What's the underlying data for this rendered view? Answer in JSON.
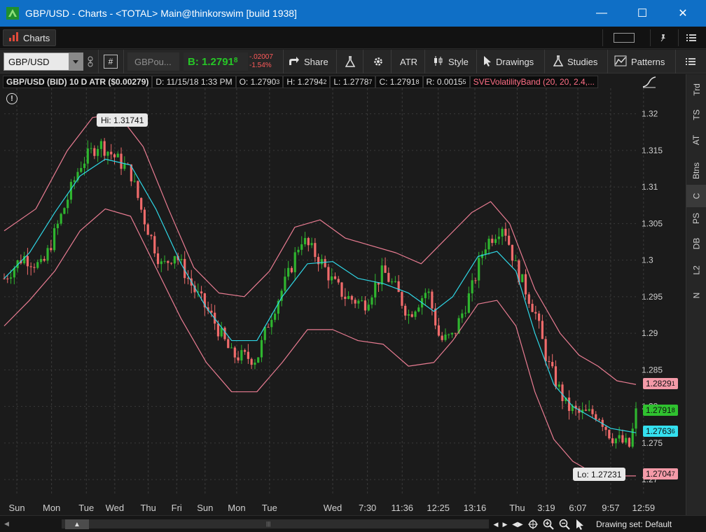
{
  "window": {
    "title": "GBP/USD - Charts - <TOTAL> Main@thinkorswim [build 1938]",
    "minimize_glyph": "—",
    "maximize_glyph": "☐",
    "close_glyph": "✕"
  },
  "bar2": {
    "charts_label": "Charts"
  },
  "toolbar": {
    "symbol": "GBP/USD",
    "hash": "#",
    "symbol2": "GBPou...",
    "bid_label": "B: 1.2791",
    "bid_sub": "8",
    "change": "-.02007",
    "change_pct": "-1.54%",
    "share": "Share",
    "atr": "ATR",
    "style": "Style",
    "drawings": "Drawings",
    "studies": "Studies",
    "patterns": "Patterns"
  },
  "chart_header": {
    "title": "GBP/USD (BID) 10 D ATR ($0.00279)",
    "d": "D: 11/15/18 1:33 PM",
    "o": "O: 1.2790",
    "o_sub": "3",
    "h": "H: 1.2794",
    "h_sub": "2",
    "l": "L: 1.2778",
    "l_sub": "7",
    "c": "C: 1.2791",
    "c_sub": "8",
    "r": "R: 0.0015",
    "r_sub": "5",
    "study": "SVEVolatilityBand (20, 20, 2.4,..."
  },
  "info_glyph": "!",
  "callouts": {
    "hi": "Hi: 1.31741",
    "lo": "Lo: 1.27231"
  },
  "price_tags": {
    "upper": "1.2829",
    "upper_sub": "1",
    "close": "1.2791",
    "close_sub": "8",
    "mid": "1.2763",
    "mid_sub": "6",
    "lower": "1.2704",
    "lower_sub": "7"
  },
  "right_tabs": [
    "Trd",
    "TS",
    "AT",
    "Btns",
    "C",
    "PS",
    "DB",
    "L2",
    "N"
  ],
  "bottom": {
    "drawing_set": "Drawing set: Default"
  },
  "colors": {
    "up": "#2fb52f",
    "down": "#f06b6b",
    "band": "#e97c92",
    "mid": "#2fd7e6",
    "grid": "#3a3a3a",
    "bid": "#26c726"
  },
  "chart_data": {
    "type": "candlestick",
    "title": "GBP/USD (BID) 10 D ATR ($0.00279)",
    "ylim": [
      1.268,
      1.3235
    ],
    "y_ticks": [
      "1.32",
      "1.315",
      "1.31",
      "1.305",
      "1.3",
      "1.295",
      "1.29",
      "1.285",
      "1.28",
      "1.275",
      "1.27"
    ],
    "x_ticks": [
      "Sun",
      "Mon",
      "Tue",
      "Wed",
      "Thu",
      "Fri",
      "Sun",
      "Mon",
      "Tue",
      "Wed",
      "7:30",
      "11:36",
      "12:25",
      "13:16",
      "Thu",
      "3:19",
      "6:07",
      "9:57",
      "12:59"
    ],
    "x_tick_positions": [
      0.02,
      0.075,
      0.13,
      0.175,
      0.228,
      0.273,
      0.318,
      0.368,
      0.42,
      0.52,
      0.575,
      0.63,
      0.687,
      0.745,
      0.812,
      0.858,
      0.908,
      0.96,
      1.012
    ],
    "close_path": [
      [
        0.0,
        1.2975
      ],
      [
        0.03,
        1.3005
      ],
      [
        0.06,
        1.299
      ],
      [
        0.09,
        1.306
      ],
      [
        0.12,
        1.313
      ],
      [
        0.15,
        1.316
      ],
      [
        0.17,
        1.3145
      ],
      [
        0.2,
        1.312
      ],
      [
        0.22,
        1.306
      ],
      [
        0.25,
        1.299
      ],
      [
        0.27,
        1.301
      ],
      [
        0.3,
        1.296
      ],
      [
        0.33,
        1.292
      ],
      [
        0.36,
        1.287
      ],
      [
        0.4,
        1.2865
      ],
      [
        0.42,
        1.292
      ],
      [
        0.45,
        1.298
      ],
      [
        0.47,
        1.303
      ],
      [
        0.5,
        1.3
      ],
      [
        0.52,
        1.297
      ],
      [
        0.54,
        1.295
      ],
      [
        0.57,
        1.294
      ],
      [
        0.6,
        1.2985
      ],
      [
        0.62,
        1.296
      ],
      [
        0.64,
        1.2925
      ],
      [
        0.67,
        1.296
      ],
      [
        0.69,
        1.289
      ],
      [
        0.71,
        1.2895
      ],
      [
        0.74,
        1.296
      ],
      [
        0.76,
        1.302
      ],
      [
        0.79,
        1.305
      ],
      [
        0.81,
        1.299
      ],
      [
        0.84,
        1.293
      ],
      [
        0.86,
        1.286
      ],
      [
        0.89,
        1.28
      ],
      [
        0.91,
        1.279
      ],
      [
        0.94,
        1.279
      ],
      [
        0.96,
        1.276
      ],
      [
        0.99,
        1.2745
      ],
      [
        1.0,
        1.2791
      ]
    ],
    "series": [
      {
        "name": "upper-band",
        "points": [
          [
            0.0,
            1.304
          ],
          [
            0.05,
            1.307
          ],
          [
            0.1,
            1.315
          ],
          [
            0.14,
            1.3195
          ],
          [
            0.18,
            1.32
          ],
          [
            0.22,
            1.3155
          ],
          [
            0.26,
            1.307
          ],
          [
            0.3,
            1.299
          ],
          [
            0.34,
            1.2955
          ],
          [
            0.38,
            1.295
          ],
          [
            0.42,
            1.2985
          ],
          [
            0.46,
            1.3045
          ],
          [
            0.5,
            1.3055
          ],
          [
            0.54,
            1.303
          ],
          [
            0.58,
            1.302
          ],
          [
            0.62,
            1.301
          ],
          [
            0.66,
            1.2995
          ],
          [
            0.7,
            1.303
          ],
          [
            0.74,
            1.3065
          ],
          [
            0.77,
            1.308
          ],
          [
            0.8,
            1.305
          ],
          [
            0.84,
            1.296
          ],
          [
            0.88,
            1.29
          ],
          [
            0.91,
            1.287
          ],
          [
            0.94,
            1.2855
          ],
          [
            0.97,
            1.2835
          ],
          [
            1.0,
            1.283
          ]
        ]
      },
      {
        "name": "mid-band",
        "points": [
          [
            0.0,
            1.2975
          ],
          [
            0.04,
            1.301
          ],
          [
            0.08,
            1.3065
          ],
          [
            0.12,
            1.3115
          ],
          [
            0.16,
            1.3138
          ],
          [
            0.2,
            1.313
          ],
          [
            0.24,
            1.307
          ],
          [
            0.28,
            1.2995
          ],
          [
            0.32,
            1.2935
          ],
          [
            0.36,
            1.289
          ],
          [
            0.4,
            1.289
          ],
          [
            0.44,
            1.295
          ],
          [
            0.48,
            1.2995
          ],
          [
            0.52,
            1.2998
          ],
          [
            0.56,
            1.2975
          ],
          [
            0.6,
            1.2968
          ],
          [
            0.64,
            1.2955
          ],
          [
            0.68,
            1.293
          ],
          [
            0.71,
            1.295
          ],
          [
            0.75,
            1.3005
          ],
          [
            0.78,
            1.3012
          ],
          [
            0.81,
            1.2985
          ],
          [
            0.84,
            1.29
          ],
          [
            0.87,
            1.283
          ],
          [
            0.9,
            1.28
          ],
          [
            0.93,
            1.2785
          ],
          [
            0.96,
            1.277
          ],
          [
            1.0,
            1.2764
          ]
        ]
      },
      {
        "name": "lower-band",
        "points": [
          [
            0.0,
            1.291
          ],
          [
            0.04,
            1.2945
          ],
          [
            0.08,
            1.2985
          ],
          [
            0.12,
            1.304
          ],
          [
            0.16,
            1.307
          ],
          [
            0.2,
            1.306
          ],
          [
            0.24,
            1.299
          ],
          [
            0.28,
            1.292
          ],
          [
            0.32,
            1.286
          ],
          [
            0.36,
            1.282
          ],
          [
            0.4,
            1.282
          ],
          [
            0.44,
            1.286
          ],
          [
            0.48,
            1.2905
          ],
          [
            0.52,
            1.2905
          ],
          [
            0.56,
            1.289
          ],
          [
            0.6,
            1.2885
          ],
          [
            0.64,
            1.2855
          ],
          [
            0.68,
            1.286
          ],
          [
            0.71,
            1.289
          ],
          [
            0.75,
            1.294
          ],
          [
            0.78,
            1.2945
          ],
          [
            0.81,
            1.291
          ],
          [
            0.84,
            1.282
          ],
          [
            0.87,
            1.2755
          ],
          [
            0.9,
            1.2725
          ],
          [
            0.93,
            1.271
          ],
          [
            0.96,
            1.2705
          ],
          [
            1.0,
            1.2705
          ]
        ]
      }
    ],
    "hi": 1.31741,
    "lo": 1.27231,
    "last": 1.27918
  }
}
